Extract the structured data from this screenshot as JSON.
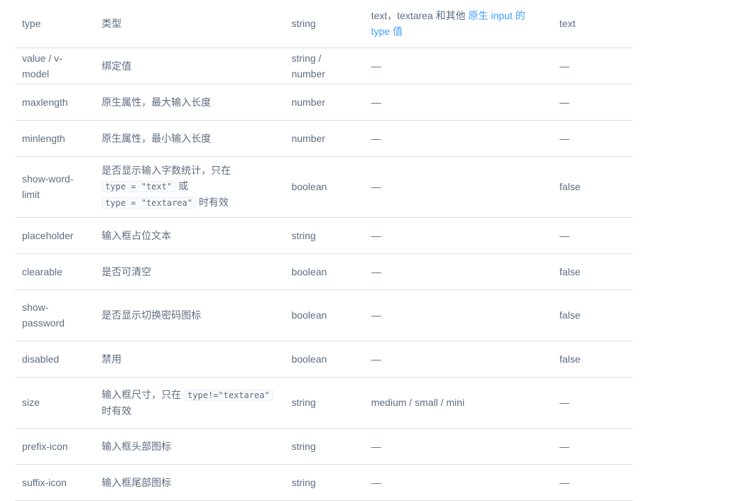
{
  "rows": [
    {
      "param": "type",
      "desc": "类型",
      "type": "string",
      "options_text": "text，textarea 和其他 ",
      "options_link": "原生 input 的 type 值",
      "default": "text"
    },
    {
      "param": "value / v-model",
      "desc": "绑定值",
      "type": "string / number",
      "options": "—",
      "default": "—"
    },
    {
      "param": "maxlength",
      "desc": "原生属性，最大输入长度",
      "type": "number",
      "options": "—",
      "default": "—"
    },
    {
      "param": "minlength",
      "desc": "原生属性，最小输入长度",
      "type": "number",
      "options": "—",
      "default": "—"
    },
    {
      "param": "show-word-limit",
      "desc_a": "是否显示输入字数统计，只在 ",
      "desc_code1": "type = \"text\"",
      "desc_b": " 或 ",
      "desc_code2": "type = \"textarea\"",
      "desc_c": " 时有效",
      "type": "boolean",
      "options": "—",
      "default": "false"
    },
    {
      "param": "placeholder",
      "desc": "输入框占位文本",
      "type": "string",
      "options": "—",
      "default": "—"
    },
    {
      "param": "clearable",
      "desc": "是否可清空",
      "type": "boolean",
      "options": "—",
      "default": "false"
    },
    {
      "param": "show-password",
      "desc": "是否显示切换密码图标",
      "type": "boolean",
      "options": "—",
      "default": "false"
    },
    {
      "param": "disabled",
      "desc": "禁用",
      "type": "boolean",
      "options": "—",
      "default": "false"
    },
    {
      "param": "size",
      "desc_a": "输入框尺寸，只在 ",
      "desc_code1": "type!=\"textarea\"",
      "desc_c": " 时有效",
      "type": "string",
      "options": "medium / small / mini",
      "default": "—"
    },
    {
      "param": "prefix-icon",
      "desc": "输入框头部图标",
      "type": "string",
      "options": "—",
      "default": "—"
    },
    {
      "param": "suffix-icon",
      "desc": "输入框尾部图标",
      "type": "string",
      "options": "—",
      "default": "—"
    }
  ],
  "colors": {
    "text": "#5e6d82",
    "link": "#409eff",
    "border": "#dcdfe6",
    "code_bg": "#f9fafc"
  }
}
